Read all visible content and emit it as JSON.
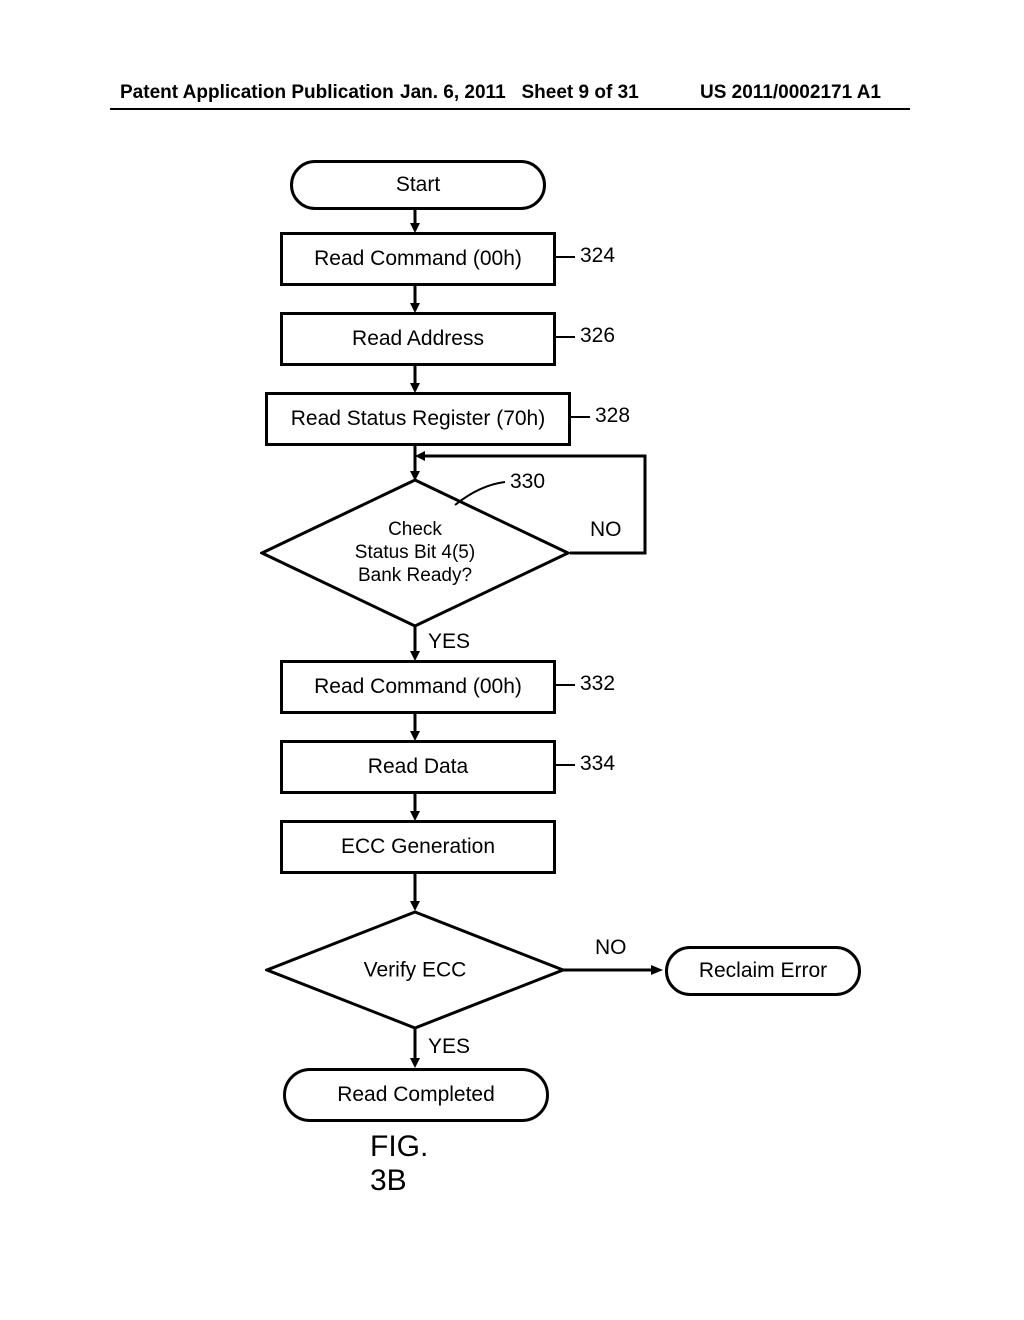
{
  "header": {
    "left": "Patent Application Publication",
    "date": "Jan. 6, 2011",
    "sheet": "Sheet 9 of 31",
    "pubnum": "US 2011/0002171 A1"
  },
  "flowchart": {
    "start": "Start",
    "step324": "Read Command (00h)",
    "ref324": "324",
    "step326": "Read Address",
    "ref326": "326",
    "step328": "Read Status Register (70h)",
    "ref328": "328",
    "dec330": "Check\nStatus Bit 4(5)\nBank Ready?",
    "ref330": "330",
    "dec330_no": "NO",
    "dec330_yes": "YES",
    "step332": "Read Command (00h)",
    "ref332": "332",
    "step334": "Read Data",
    "ref334": "334",
    "step_ecc": "ECC Generation",
    "dec_verify": "Verify ECC",
    "dec_verify_no": "NO",
    "dec_verify_yes": "YES",
    "reclaim": "Reclaim Error",
    "completed": "Read Completed"
  },
  "figure_label": "FIG. 3B"
}
